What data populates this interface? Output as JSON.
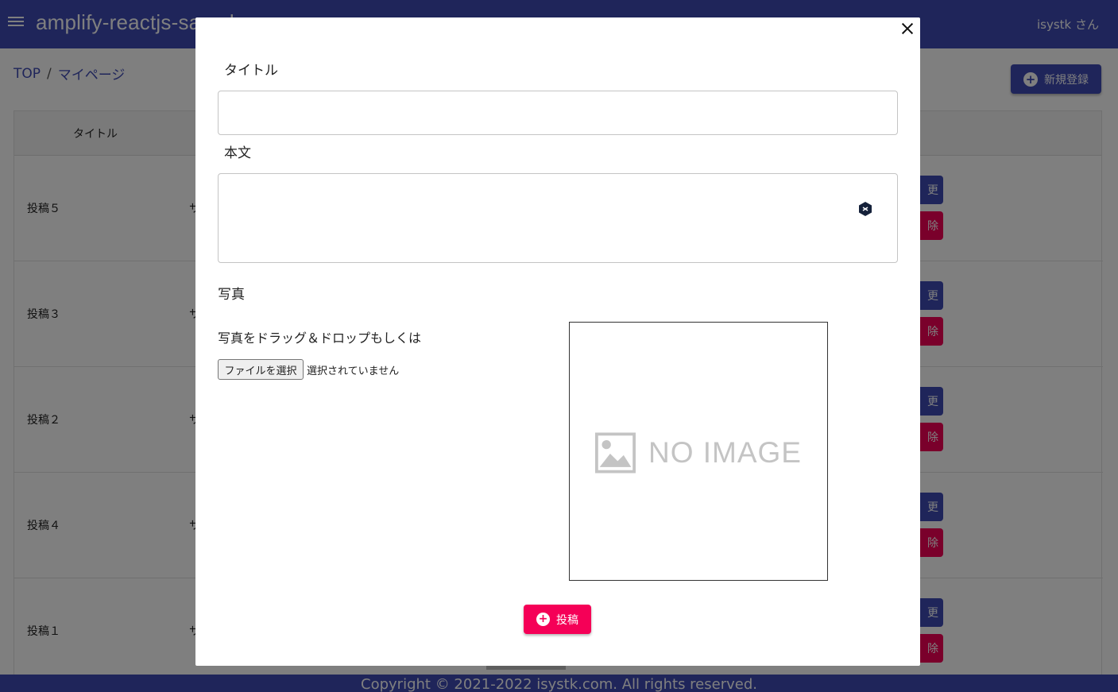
{
  "app": {
    "title": "amplify-reactjs-sample",
    "user": "isystk さん"
  },
  "breadcrumb": {
    "items": [
      "TOP",
      "マイページ"
    ],
    "separator": "/"
  },
  "toolbar": {
    "new_label": "新規登録",
    "new_icon": "add-circle-icon"
  },
  "table": {
    "header": {
      "title": "タイトル"
    },
    "rows": [
      {
        "title": "投稿５",
        "sub": "サ",
        "edit": "更",
        "delete": "除"
      },
      {
        "title": "投稿３",
        "sub": "サ",
        "edit": "更",
        "delete": "除"
      },
      {
        "title": "投稿２",
        "sub": "サ",
        "edit": "更",
        "delete": "除"
      },
      {
        "title": "投稿４",
        "sub": "サ",
        "edit": "更",
        "delete": "除"
      },
      {
        "title": "投稿１",
        "sub": "サ",
        "edit": "更",
        "delete": "除"
      }
    ]
  },
  "footer": {
    "text": "Copyright © 2021-2022 isystk.com. All rights reserved."
  },
  "modal": {
    "close_icon": "close-icon",
    "title_label": "タイトル",
    "title_value": "",
    "body_label": "本文",
    "body_value": "",
    "photo_label": "写真",
    "drop_text": "写真をドラッグ＆ドロップもしくは",
    "file_button": "ファイルを選択",
    "file_status": "選択されていません",
    "preview_text": "NO IMAGE",
    "submit_label": "投稿",
    "submit_icon": "add-circle-icon"
  },
  "colors": {
    "primary": "#3f4bb5",
    "secondary": "#f50057",
    "overlay": "rgba(0,0,0,0.5)"
  }
}
